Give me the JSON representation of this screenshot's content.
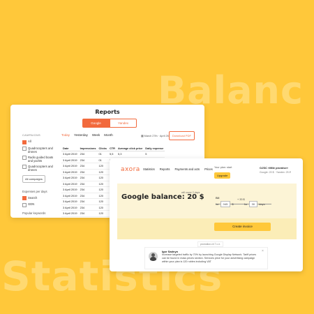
{
  "background": {
    "word_top": "Balanc",
    "word_bottom": "Statistics",
    "color": "#FFC83A"
  },
  "reports": {
    "title": "Reports",
    "toggle": {
      "google": "Google",
      "yandex": "Yandex"
    },
    "sidebar": {
      "campaigns_heading": "CAMPAIGNS",
      "items": [
        "All",
        "Quadrocopters and drones",
        "Radio guided boats and yachts",
        "Quadrocopters and drones"
      ],
      "all_campaigns_button": "All campaigns",
      "expenses_heading": "Expenses per days",
      "expense_items": [
        "Search",
        "GDN"
      ],
      "popular_keywords": "Popular keywords"
    },
    "filters": [
      "Today",
      "Yesterday",
      "Week",
      "Month"
    ],
    "date_range": "March 27th · April 26",
    "download_button": "Download PDF",
    "table": {
      "headers": [
        "Date",
        "Impressions",
        "Clicks",
        "CTR",
        "Average click price",
        "Daily expense"
      ],
      "rows": [
        [
          "3 April 2019",
          "234",
          "01",
          "5,5",
          "5,3",
          "5"
        ],
        [
          "3 April 2019",
          "234",
          "01",
          "5,5",
          "5,3",
          "5"
        ],
        [
          "3 April 2019",
          "234",
          "120",
          "",
          "",
          ""
        ],
        [
          "3 April 2019",
          "234",
          "120",
          "",
          "",
          ""
        ],
        [
          "3 April 2019",
          "234",
          "120",
          "",
          "",
          ""
        ],
        [
          "3 April 2019",
          "234",
          "120",
          "",
          "",
          ""
        ],
        [
          "3 April 2019",
          "234",
          "120",
          "",
          "",
          ""
        ],
        [
          "3 April 2019",
          "234",
          "120",
          "",
          "",
          ""
        ],
        [
          "3 April 2019",
          "234",
          "120",
          "",
          "",
          ""
        ],
        [
          "3 April 2019",
          "234",
          "120",
          "",
          "",
          ""
        ],
        [
          "3 April 2019",
          "234",
          "120",
          "",
          "",
          ""
        ],
        [
          "3 April 2019",
          "234",
          "120",
          "",
          "",
          ""
        ],
        [
          "3 April 2019",
          "234",
          "120",
          "",
          "",
          ""
        ]
      ]
    }
  },
  "axora": {
    "logo": "axora",
    "nav": [
      "Statistics",
      "Reports",
      "Payments and acts",
      "Prices"
    ],
    "plan_label": "Your plan: start",
    "upgrade_button": "Upgrade",
    "account": "OJSC «Mile promise»",
    "account_sub": "Google: 20 $ · Yandex: 25 ₽",
    "balance": "Google balance: 20 $",
    "will_cover": "will cover 2 days",
    "bill_label": "Bill",
    "slider_value": "+ 33 $",
    "for_label": "for",
    "amount": "045",
    "currency": "$",
    "for2_label": "for",
    "days_value": "30",
    "days_label": "days",
    "create_invoice": "Create invoice",
    "promo_tag": "promotion.ch 7 с.л.",
    "testimonial": {
      "name": "Igor Sadnyn",
      "text": "Increase targeted traffic by 70% by launching Google Display Network. Tariff prices can be found in mass prices section. Services price for your advertising campaign within your plan is 120 rubles including VAT"
    }
  }
}
